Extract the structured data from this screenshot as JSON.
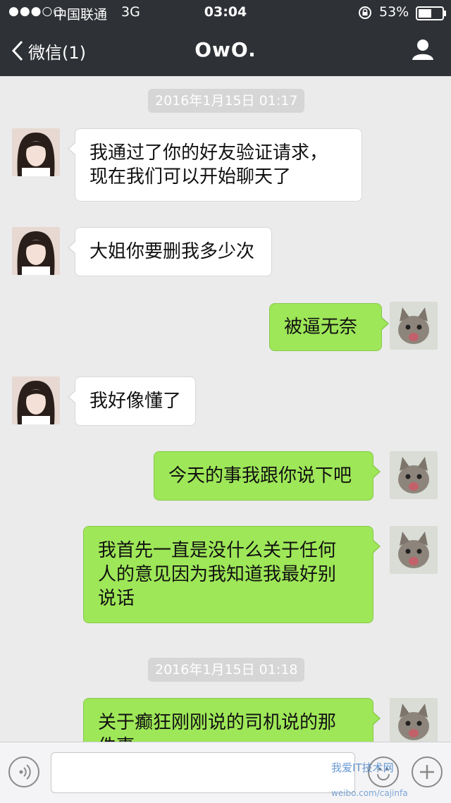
{
  "status_bar": {
    "signal": "●●●○○",
    "carrier": "中国联通",
    "network": "3G",
    "time": "03:04",
    "battery": "53%"
  },
  "nav": {
    "back_label": "微信(1)",
    "title": "OwO.",
    "icons": {
      "back": "chevron-left-icon",
      "profile": "person-icon"
    }
  },
  "messages": {
    "stamp1": "2016年1月15日 01:17",
    "m1_line1": "我通过了你的好友验证请求，",
    "m1_line2": "现在我们可以开始聊天了",
    "m2": "大姐你要删我多少次",
    "m3": "被逼无奈",
    "m4": "我好像懂了",
    "m5": "今天的事我跟你说下吧",
    "m6_line1": "我首先一直是没什么关于任何",
    "m6_line2": "人的意见因为我知道我最好别",
    "m6_line3": "说话",
    "stamp2": "2016年1月15日 01:18",
    "m7_line1": "关于癫狂刚刚说的司机说的那",
    "m7_line2": "件事"
  },
  "input_bar": {
    "icons": {
      "voice": "voice-icon",
      "emoji": "emoji-icon",
      "more": "plus-icon"
    }
  },
  "watermark": {
    "line1": "我爱IT技术网",
    "line2": "weibo.com/cajinfa"
  },
  "colors": {
    "header": "#2e3135",
    "chat_bg": "#ebebeb",
    "outgoing": "#9ee758",
    "incoming": "#ffffff"
  }
}
